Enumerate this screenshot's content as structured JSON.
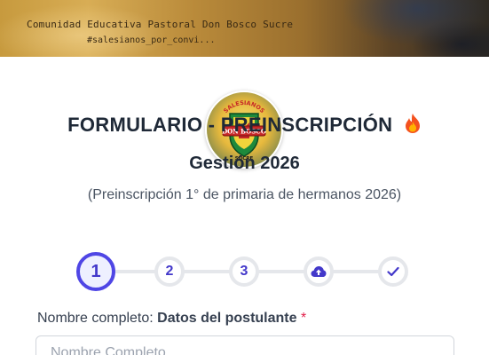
{
  "banner": {
    "line1": "Comunidad Educativa Pastoral Don Bosco Sucre",
    "line2": "#salesianos_por_convi..."
  },
  "logo": {
    "top_text": "SALESIANOS",
    "middle_text": "DON BOSCO",
    "bottom_text": "SUCRE"
  },
  "header": {
    "title": "FORMULARIO - PREINSCRIPCIÓN",
    "title_icon": "fire-icon",
    "subtitle": "Gestión 2026",
    "description": "(Preinscripción 1° de primaria de hermanos 2026)"
  },
  "stepper": {
    "steps": [
      {
        "label": "1",
        "state": "active"
      },
      {
        "label": "2",
        "state": "pending"
      },
      {
        "label": "3",
        "state": "pending"
      },
      {
        "icon": "cloud-upload-icon",
        "state": "pending"
      },
      {
        "icon": "check-icon",
        "state": "pending"
      }
    ],
    "accent_color": "#4f46e5",
    "inactive_color": "#e5e7eb"
  },
  "form": {
    "name_label_prefix": "Nombre completo:",
    "name_label_bold": "Datos del postulante",
    "required_mark": "*",
    "name_placeholder": "Nombre Completo"
  }
}
